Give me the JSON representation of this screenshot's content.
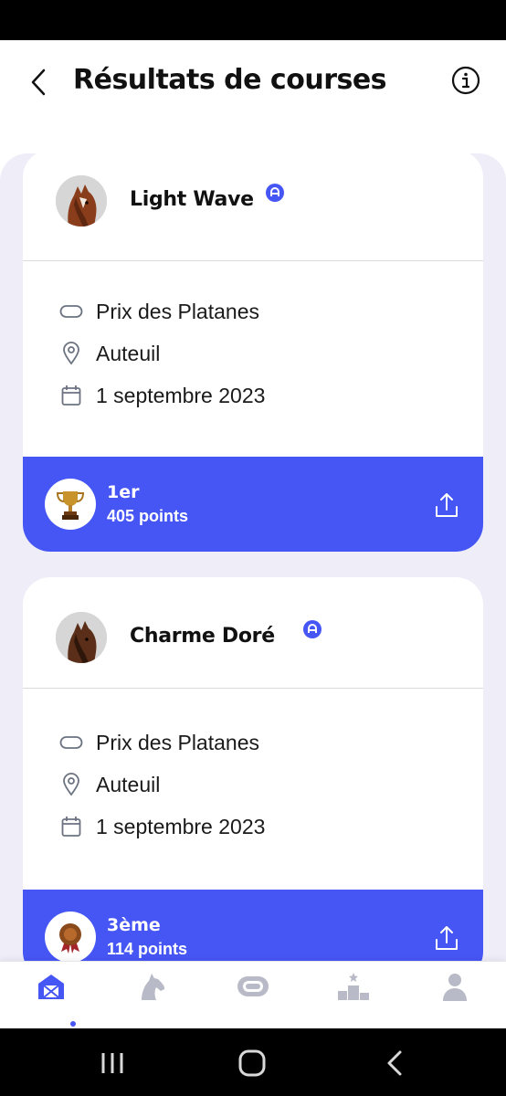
{
  "header": {
    "title": "Résultats de courses",
    "back_icon": "chevron-left-icon",
    "info_icon": "info-icon"
  },
  "colors": {
    "accent": "#4656f5",
    "scroll_background": "#eeedf8",
    "text": "#1a1a1a",
    "nav_inactive": "#b8bac7"
  },
  "results": [
    {
      "horse": "Light Wave",
      "race": "Prix des Platanes",
      "location": "Auteuil",
      "date": "1 septembre 2023",
      "rank": "1er",
      "points": "405 points",
      "medal_icon": "trophy-icon"
    },
    {
      "horse": "Charme Doré",
      "race": "Prix des Platanes",
      "location": "Auteuil",
      "date": "1 septembre 2023",
      "rank": "3ème",
      "points": "114 points",
      "medal_icon": "rosette-icon"
    }
  ],
  "bottom_nav": {
    "items": [
      "stable-icon",
      "horse-icon",
      "racetrack-icon",
      "podium-icon",
      "profile-icon"
    ],
    "active": "stable-icon"
  },
  "system_nav": [
    "recent-apps-icon",
    "home-icon",
    "back-icon"
  ]
}
